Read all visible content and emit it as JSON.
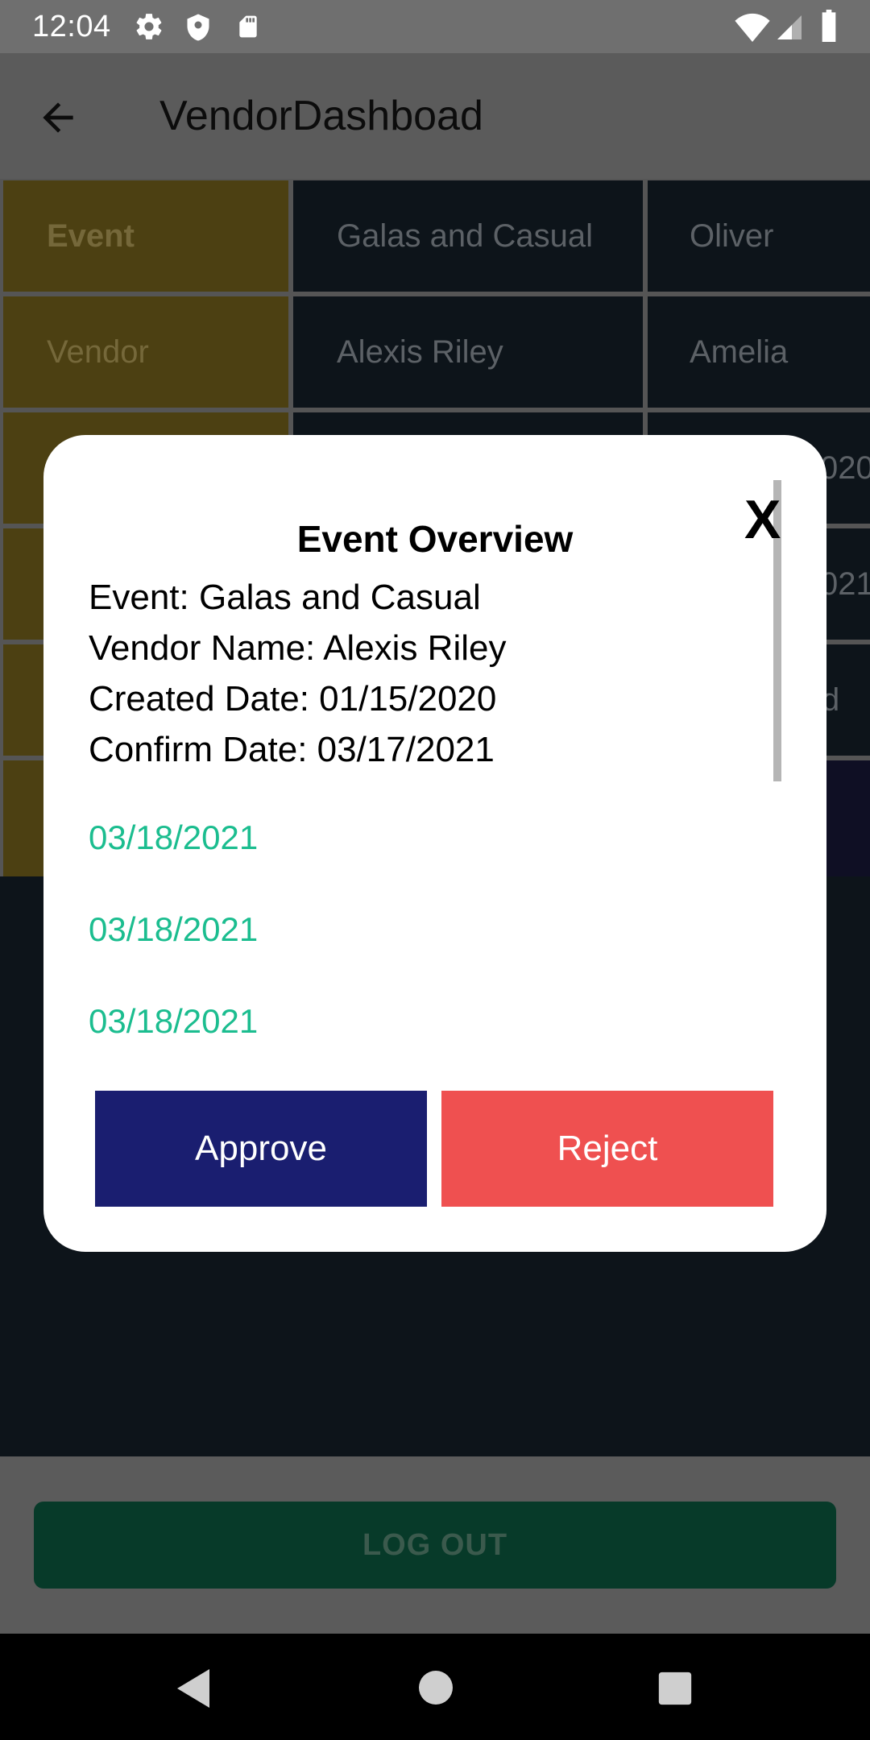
{
  "status_bar": {
    "time": "12:04",
    "icons": [
      "gear-icon",
      "shield-icon",
      "sd-card-icon",
      "wifi-icon",
      "signal-icon",
      "battery-icon"
    ]
  },
  "app_bar": {
    "title": "VendorDashboad",
    "back_icon": "arrow-back-icon"
  },
  "table": {
    "row_labels": [
      "Event",
      "Vendor"
    ],
    "rows": [
      [
        "Galas and Casual",
        "Oliver"
      ],
      [
        "Alexis Riley",
        "Amelia"
      ]
    ],
    "partial_cells": [
      "020",
      "021",
      "d"
    ]
  },
  "dialog": {
    "title": "Event Overview",
    "close_label": "X",
    "lines": [
      "Event: Galas and Casual",
      "Vendor Name: Alexis Riley",
      "Created Date: 01/15/2020",
      "Confirm Date: 03/17/2021"
    ],
    "dates": [
      "03/18/2021",
      "03/18/2021",
      "03/18/2021"
    ],
    "approve_label": "Approve",
    "reject_label": "Reject"
  },
  "logout_label": "LOG OUT",
  "colors": {
    "approve": "#1a1e70",
    "reject": "#ef5050",
    "date_text": "#1bbd8f",
    "header_cell": "#4c4012",
    "logout": "#073a29"
  },
  "nav_bar": {
    "icons": [
      "nav-back-icon",
      "nav-home-icon",
      "nav-recents-icon"
    ]
  }
}
